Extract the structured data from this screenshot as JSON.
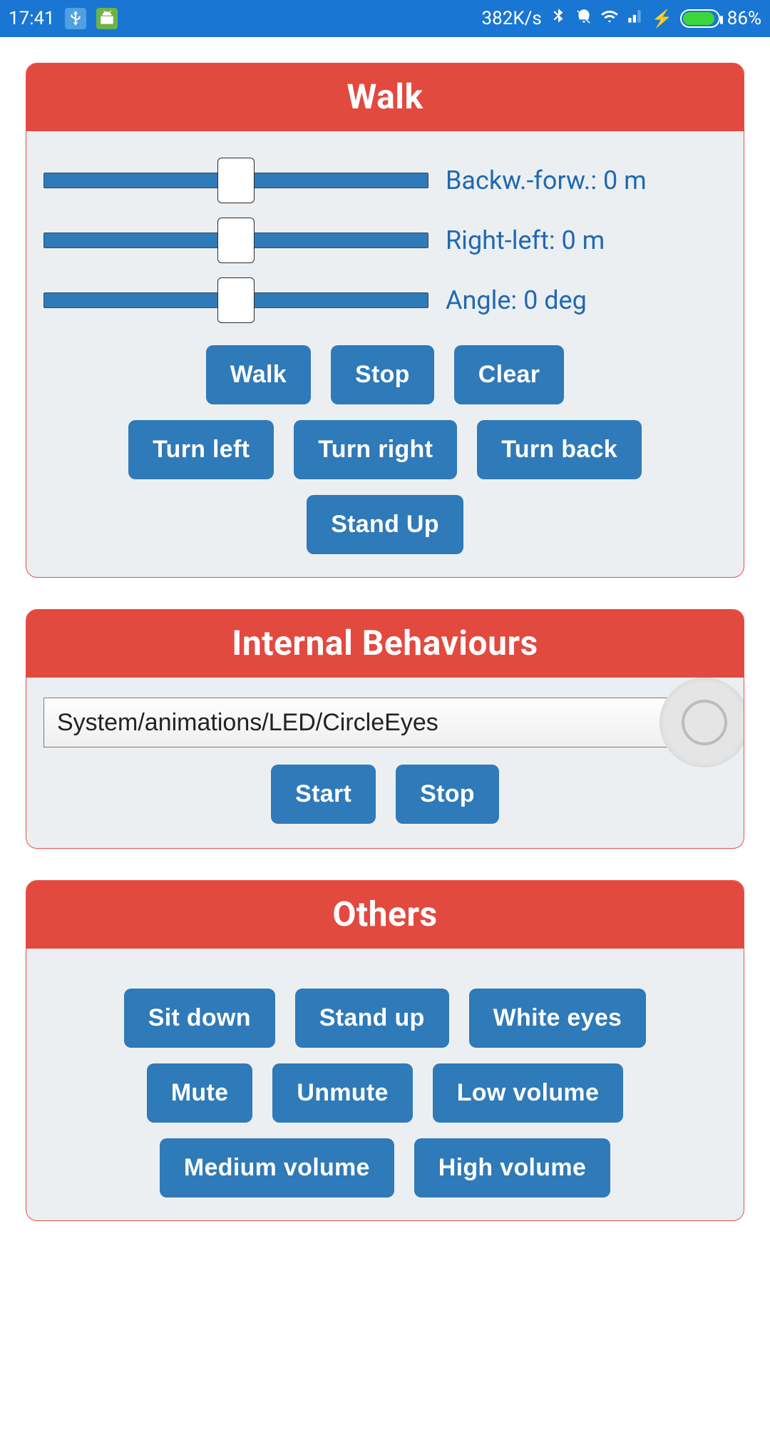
{
  "statusbar": {
    "time": "17:41",
    "net_speed": "382K/s",
    "battery_pct": "86%"
  },
  "walk": {
    "title": "Walk",
    "sliders": {
      "backw_forw": "Backw.-forw.: 0 m",
      "right_left": "Right-left: 0 m",
      "angle": "Angle: 0 deg"
    },
    "buttons": {
      "walk": "Walk",
      "stop": "Stop",
      "clear": "Clear",
      "turn_left": "Turn left",
      "turn_right": "Turn right",
      "turn_back": "Turn back",
      "stand_up": "Stand Up"
    }
  },
  "behaviours": {
    "title": "Internal Behaviours",
    "selected": "System/animations/LED/CircleEyes",
    "buttons": {
      "start": "Start",
      "stop": "Stop"
    }
  },
  "others": {
    "title": "Others",
    "buttons": {
      "sit_down": "Sit down",
      "stand_up": "Stand up",
      "white_eyes": "White eyes",
      "mute": "Mute",
      "unmute": "Unmute",
      "low_volume": "Low volume",
      "medium_volume": "Medium volume",
      "high_volume": "High volume"
    }
  }
}
